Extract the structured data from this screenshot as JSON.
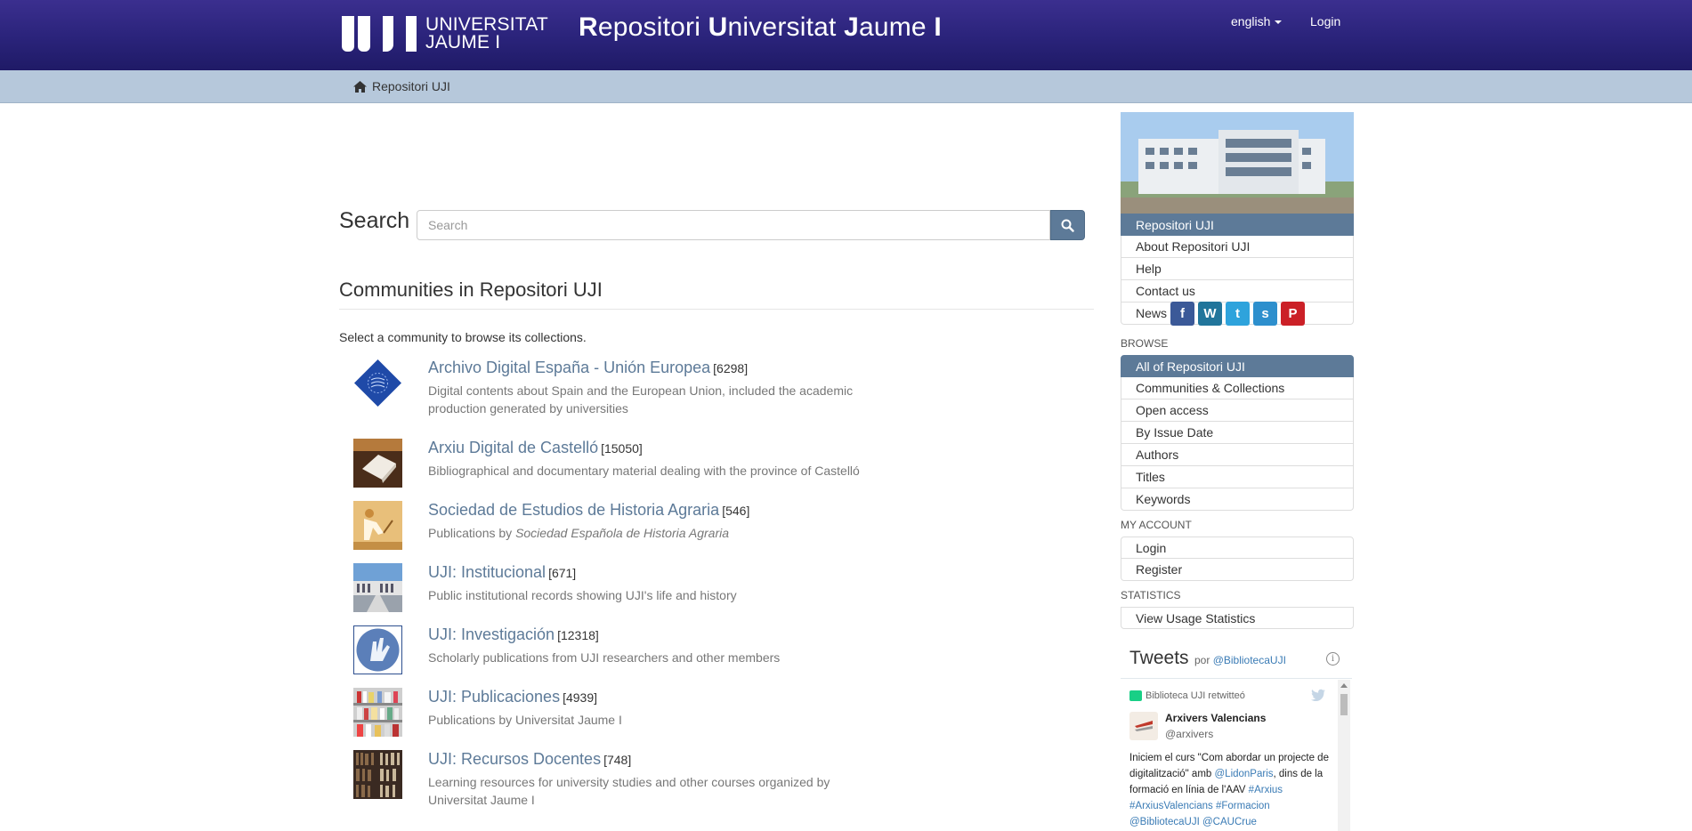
{
  "header": {
    "logo_line1": "UNIVERSITAT",
    "logo_line2": "JAUME I",
    "site_title_parts": [
      "R",
      "epositori ",
      "U",
      "niversitat ",
      "J",
      "aume ",
      "I"
    ],
    "language": "english",
    "login": "Login",
    "background": "#2a237a"
  },
  "breadcrumb": {
    "home": "Repositori UJI"
  },
  "search": {
    "label": "Search",
    "placeholder": "Search"
  },
  "communities": {
    "title": "Communities in Repositori UJI",
    "intro": "Select a community to browse its collections.",
    "items": [
      {
        "name": "Archivo Digital España - Unión Europea",
        "count": "[6298]",
        "desc": "Digital contents about Spain and the European Union, included the academic production generated by universities",
        "icon": "eu-logo-icon"
      },
      {
        "name": "Arxiu Digital de Castelló",
        "count": "[15050]",
        "desc": "Bibliographical and documentary material dealing with the province of Castelló",
        "icon": "book-photo-icon"
      },
      {
        "name": "Sociedad de Estudios de Historia Agraria",
        "count": "[546]",
        "desc_prefix": "Publications by ",
        "desc_italic": "Sociedad Española de Historia Agraria",
        "icon": "farmer-photo-icon"
      },
      {
        "name": "UJI: Institucional",
        "count": "[671]",
        "desc": "Public institutional records showing UJI's life and history",
        "icon": "campus-photo-icon"
      },
      {
        "name": "UJI: Investigación",
        "count": "[12318]",
        "desc": "Scholarly publications from UJI researchers and other members",
        "icon": "research-logo-icon"
      },
      {
        "name": "UJI: Publicaciones",
        "count": "[4939]",
        "desc": "Publications by Universitat Jaume I",
        "icon": "bookshelf-photo-icon"
      },
      {
        "name": "UJI: Recursos Docentes",
        "count": "[748]",
        "desc": "Learning resources for university studies and other courses organized by Universitat Jaume I",
        "icon": "library-photo-icon"
      }
    ]
  },
  "sidebar": {
    "repo": [
      "Repositori UJI",
      "About Repositori UJI",
      "Help",
      "Contact us",
      "News"
    ],
    "browse_head": "BROWSE",
    "browse": [
      "All of Repositori UJI",
      "Communities & Collections",
      "Open access",
      "By Issue Date",
      "Authors",
      "Titles",
      "Keywords"
    ],
    "account_head": "MY ACCOUNT",
    "account": [
      "Login",
      "Register"
    ],
    "stats_head": "STATISTICS",
    "stats": [
      "View Usage Statistics"
    ],
    "accent": "#5d7a98"
  },
  "tweets": {
    "title": "Tweets",
    "by_prefix": "por ",
    "by_handle": "@BibliotecaUJI",
    "retweeted": "Biblioteca UJI retwitteó",
    "author_name": "Arxivers Valencians",
    "author_handle": "@arxivers",
    "text_parts": [
      {
        "t": "Iniciem el curs \"Com abordar un projecte de digitalització\" amb ",
        "link": false
      },
      {
        "t": "@LidonParis",
        "link": true
      },
      {
        "t": ", dins de la formació en línia de l'AAV ",
        "link": false
      },
      {
        "t": "#Arxius",
        "link": true
      },
      {
        "t": " ",
        "link": false
      },
      {
        "t": "#ArxiusValencians",
        "link": true
      },
      {
        "t": " ",
        "link": false
      },
      {
        "t": "#Formacion",
        "link": true
      },
      {
        "t": " ",
        "link": false
      },
      {
        "t": "@BibliotecaUJI",
        "link": true
      },
      {
        "t": " ",
        "link": false
      },
      {
        "t": "@CAUCrue",
        "link": true
      }
    ]
  }
}
